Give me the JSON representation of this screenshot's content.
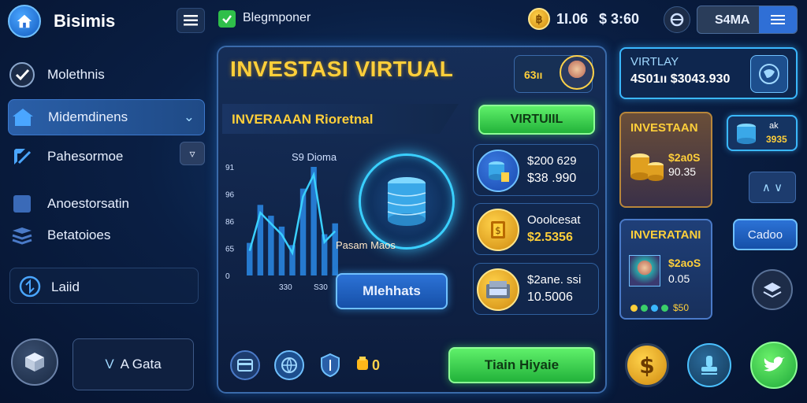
{
  "header": {
    "app_title": "Bisimis",
    "tab_label": "Blegmponer",
    "coins": "1І.06",
    "money": "$ 3:60",
    "user": "S4MA",
    "coin_symbol": "฿"
  },
  "sidebar": {
    "items": [
      {
        "label": "Molethnis",
        "icon": "check-badge-icon"
      },
      {
        "label": "Midemdinens",
        "icon": "house-icon",
        "active": true
      },
      {
        "label": "Pahesormoe",
        "icon": "edit-icon"
      },
      {
        "label": "Anoestorsatin",
        "icon": "folder-icon"
      },
      {
        "label": "Betatoioes",
        "icon": "stack-icon"
      },
      {
        "label": "Laiid",
        "icon": "sync-icon"
      }
    ],
    "bottom_label": "A Gata",
    "bottom_prefix": "V"
  },
  "main": {
    "title": "INVESTASI VIRTUAL",
    "level": "63ıı",
    "subheading": "INVERAAAN Rioretnal",
    "virtual_button": "VIRTUIIL",
    "chart_title": "S9 Dioma",
    "vault_label": "Pasam Maos",
    "action_button": "Mlehhats",
    "trade_button": "Tiain Hiyaie",
    "gold_value": "0",
    "assets": [
      {
        "line1": "$200 629",
        "line2": "$38 .990",
        "icon": "coins-stack-icon"
      },
      {
        "line1": "Ooolcesat",
        "line2": "$2.5356",
        "icon": "gold-bar-icon"
      },
      {
        "line1": "$2ane. ssi",
        "line2": "10.5006",
        "icon": "cash-register-icon"
      }
    ]
  },
  "chart_data": {
    "type": "bar",
    "title": "S9 Dioma",
    "y_tick_labels": [
      "91",
      "96",
      "86",
      "65",
      "0"
    ],
    "x_tick_labels": [
      "330",
      "S30"
    ],
    "values": [
      30,
      65,
      55,
      45,
      28,
      80,
      100,
      38,
      48
    ],
    "ylim": [
      0,
      100
    ],
    "trend": "up"
  },
  "right_panel": {
    "top_card": {
      "label": "VIRTLAY",
      "value": "4S01ıı $3043.930"
    },
    "invest_card": {
      "title": "INVESTAAN",
      "v1": "$2a0S",
      "v2": "90.35"
    },
    "invert_card": {
      "title": "INVERATANI",
      "v1": "$2aoS",
      "v2": "0.05",
      "footer": "$50"
    },
    "small_card": {
      "a": "ak",
      "b": "3935"
    },
    "chevron_label": "∧ ∨",
    "cado_button": "Cadoo"
  },
  "colors": {
    "gold": "#ffcf3a",
    "green": "#2fbf4a",
    "accent_blue": "#3ab8ff",
    "bg": "#0a1f44"
  }
}
